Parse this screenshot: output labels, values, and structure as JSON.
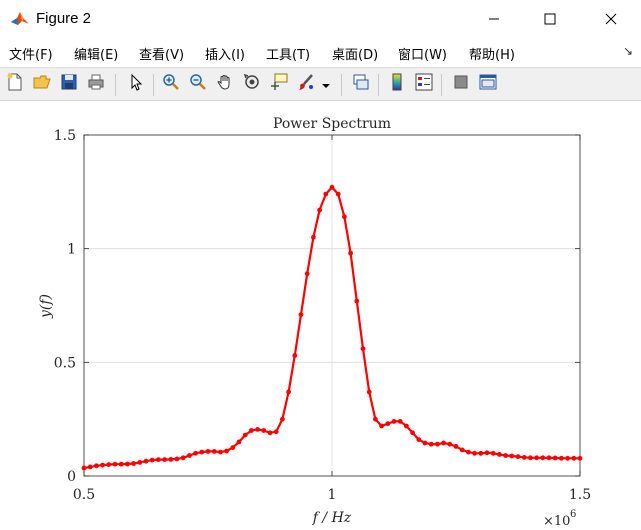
{
  "window": {
    "title": "Figure 2"
  },
  "menu": {
    "items": [
      {
        "label": "文件(F)",
        "name": "menu-file"
      },
      {
        "label": "编辑(E)",
        "name": "menu-edit"
      },
      {
        "label": "查看(V)",
        "name": "menu-view"
      },
      {
        "label": "插入(I)",
        "name": "menu-insert"
      },
      {
        "label": "工具(T)",
        "name": "menu-tools"
      },
      {
        "label": "桌面(D)",
        "name": "menu-desktop"
      },
      {
        "label": "窗口(W)",
        "name": "menu-window"
      },
      {
        "label": "帮助(H)",
        "name": "menu-help"
      }
    ],
    "overflow_glyph": "↘"
  },
  "toolbar": {
    "icons": [
      "new-figure-icon",
      "open-file-icon",
      "save-icon",
      "print-icon",
      "pointer-icon",
      "zoom-in-icon",
      "zoom-out-icon",
      "pan-hand-icon",
      "rotate-3d-icon",
      "data-cursor-icon",
      "brush-icon",
      "brush-dropdown-icon",
      "link-plot-icon",
      "colorbar-icon",
      "legend-icon",
      "hide-plot-tools-icon",
      "show-plot-tools-icon"
    ]
  },
  "chart_data": {
    "type": "line",
    "title": "Power Spectrum",
    "xlabel": "f / Hz",
    "ylabel": "y(f)",
    "xlim": [
      500000,
      1500000
    ],
    "ylim": [
      0,
      1.5
    ],
    "x_exponent_label": "×10",
    "x_exponent_value": "6",
    "xticks": [
      {
        "value": 500000,
        "label": "0.5"
      },
      {
        "value": 1000000,
        "label": "1"
      },
      {
        "value": 1500000,
        "label": "1.5"
      }
    ],
    "yticks": [
      {
        "value": 0,
        "label": "0"
      },
      {
        "value": 0.5,
        "label": "0.5"
      },
      {
        "value": 1,
        "label": "1"
      },
      {
        "value": 1.5,
        "label": "1.5"
      }
    ],
    "grid": true,
    "color": "#ff0000",
    "series": [
      {
        "marker": "dot",
        "x": [
          500000,
          512500,
          525000,
          537500,
          550000,
          562500,
          575000,
          587500,
          600000,
          612500,
          625000,
          637500,
          650000,
          662500,
          675000,
          687500,
          700000,
          712500,
          725000,
          737500,
          750000,
          762500,
          775000,
          787500,
          800000,
          812500,
          825000,
          837500,
          850000,
          862500,
          875000,
          887500,
          900000,
          912500,
          925000,
          937500,
          950000,
          962500,
          975000,
          987500,
          1000000,
          1012500,
          1025000,
          1037500,
          1050000,
          1062500,
          1075000,
          1087500,
          1100000,
          1112500,
          1125000,
          1137500,
          1150000,
          1162500,
          1175000,
          1187500,
          1200000,
          1212500,
          1225000,
          1237500,
          1250000,
          1262500,
          1275000,
          1287500,
          1300000,
          1312500,
          1325000,
          1337500,
          1350000,
          1362500,
          1375000,
          1387500,
          1400000,
          1412500,
          1425000,
          1437500,
          1450000,
          1462500,
          1475000,
          1487500,
          1500000
        ],
        "y": [
          0.035,
          0.04,
          0.045,
          0.048,
          0.05,
          0.052,
          0.052,
          0.053,
          0.055,
          0.06,
          0.065,
          0.07,
          0.072,
          0.072,
          0.073,
          0.075,
          0.08,
          0.09,
          0.1,
          0.105,
          0.108,
          0.108,
          0.105,
          0.11,
          0.125,
          0.15,
          0.18,
          0.2,
          0.205,
          0.2,
          0.19,
          0.195,
          0.25,
          0.37,
          0.53,
          0.71,
          0.89,
          1.05,
          1.17,
          1.24,
          1.27,
          1.24,
          1.14,
          0.98,
          0.77,
          0.56,
          0.37,
          0.25,
          0.22,
          0.23,
          0.24,
          0.24,
          0.22,
          0.19,
          0.16,
          0.145,
          0.14,
          0.14,
          0.145,
          0.14,
          0.13,
          0.115,
          0.105,
          0.1,
          0.1,
          0.102,
          0.1,
          0.095,
          0.09,
          0.088,
          0.085,
          0.082,
          0.08,
          0.08,
          0.08,
          0.08,
          0.079,
          0.078,
          0.078,
          0.078,
          0.078
        ]
      }
    ]
  }
}
